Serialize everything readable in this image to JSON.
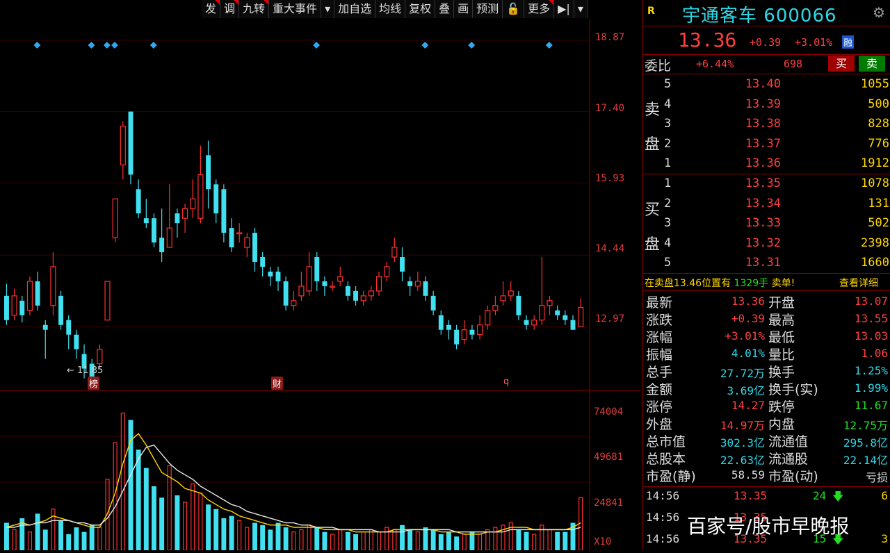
{
  "toolbar": {
    "items": [
      {
        "label": "发",
        "mark": true
      },
      {
        "label": "调",
        "mark": true
      },
      {
        "label": "九转",
        "mark": true
      },
      {
        "label": "重大事件",
        "mark": false
      },
      {
        "label": "▾",
        "mark": false
      },
      {
        "label": "加自选",
        "mark": false
      },
      {
        "label": "均线",
        "mark": false
      },
      {
        "label": "复权",
        "mark": false
      },
      {
        "label": "叠",
        "mark": false
      },
      {
        "label": "画",
        "mark": false
      },
      {
        "label": "预测",
        "mark": false
      },
      {
        "label": "🔓",
        "mark": false
      },
      {
        "label": "更多",
        "mark": true
      },
      {
        "label": "▶|",
        "mark": false
      },
      {
        "label": "▾",
        "mark": false
      }
    ]
  },
  "chart": {
    "price_labels": [
      "18.87",
      "17.40",
      "15.93",
      "14.44",
      "12.97"
    ],
    "low_marker": "11.85",
    "event_badges": [
      {
        "label": "榜",
        "color": "#c00000",
        "bg": "#5a0000"
      },
      {
        "label": "财",
        "color": "#c00000",
        "bg": "#5a0000"
      },
      {
        "label": "q",
        "color": "#c00000",
        "bg": "#000"
      }
    ],
    "volume_labels": [
      "74004",
      "49681",
      "24841"
    ],
    "volume_unit": "X10"
  },
  "chart_data": {
    "type": "candlestick",
    "ylim": [
      11.85,
      18.87
    ],
    "candles": [
      [
        13.6,
        13.1,
        13.85,
        13.0
      ],
      [
        13.2,
        13.6,
        13.75,
        13.1
      ],
      [
        13.5,
        13.2,
        13.6,
        13.05
      ],
      [
        13.3,
        13.9,
        14.0,
        13.2
      ],
      [
        13.9,
        13.4,
        14.1,
        13.3
      ],
      [
        13.0,
        12.9,
        13.1,
        12.3
      ],
      [
        13.4,
        14.2,
        14.5,
        13.2
      ],
      [
        13.6,
        13.0,
        13.7,
        12.9
      ],
      [
        13.1,
        12.8,
        13.2,
        12.5
      ],
      [
        12.8,
        12.5,
        12.9,
        12.3
      ],
      [
        12.4,
        12.1,
        12.6,
        11.9
      ],
      [
        12.2,
        11.9,
        12.3,
        11.85
      ],
      [
        12.2,
        12.5,
        12.6,
        12.1
      ],
      [
        13.1,
        13.9,
        13.9,
        13.1
      ],
      [
        14.8,
        15.6,
        15.6,
        14.7
      ],
      [
        16.3,
        17.1,
        17.2,
        16.0
      ],
      [
        17.4,
        16.1,
        17.4,
        15.9
      ],
      [
        15.8,
        15.3,
        16.0,
        15.2
      ],
      [
        15.2,
        15.1,
        15.6,
        15.0
      ],
      [
        15.2,
        14.7,
        15.3,
        14.6
      ],
      [
        14.8,
        14.5,
        15.4,
        14.3
      ],
      [
        14.6,
        15.0,
        15.9,
        14.6
      ],
      [
        15.3,
        15.1,
        15.4,
        14.8
      ],
      [
        15.2,
        15.4,
        15.5,
        14.9
      ],
      [
        15.4,
        15.6,
        16.0,
        15.2
      ],
      [
        15.2,
        16.1,
        16.7,
        15.1
      ],
      [
        16.5,
        15.8,
        16.8,
        15.4
      ],
      [
        15.9,
        15.3,
        16.0,
        15.1
      ],
      [
        15.8,
        14.9,
        15.9,
        14.7
      ],
      [
        15.0,
        14.6,
        15.2,
        14.5
      ],
      [
        14.9,
        14.9,
        15.1,
        14.7
      ],
      [
        14.6,
        14.8,
        14.9,
        14.4
      ],
      [
        14.9,
        14.3,
        15.0,
        14.1
      ],
      [
        14.4,
        14.2,
        14.5,
        14.0
      ],
      [
        14.1,
        14.0,
        14.2,
        13.8
      ],
      [
        14.1,
        13.9,
        14.2,
        13.7
      ],
      [
        13.9,
        13.4,
        14.0,
        13.3
      ],
      [
        13.4,
        13.5,
        13.7,
        13.3
      ],
      [
        13.6,
        13.8,
        14.1,
        13.5
      ],
      [
        13.7,
        14.2,
        14.5,
        13.6
      ],
      [
        14.4,
        13.9,
        14.5,
        13.7
      ],
      [
        13.9,
        13.8,
        14.0,
        13.6
      ],
      [
        13.8,
        13.8,
        13.9,
        13.7
      ],
      [
        13.9,
        14.0,
        14.2,
        13.8
      ],
      [
        13.8,
        13.6,
        13.9,
        13.5
      ],
      [
        13.7,
        13.5,
        13.8,
        13.4
      ],
      [
        13.5,
        13.6,
        13.7,
        13.4
      ],
      [
        13.6,
        13.7,
        13.8,
        13.5
      ],
      [
        13.7,
        14.0,
        14.1,
        13.6
      ],
      [
        14.0,
        14.2,
        14.3,
        13.9
      ],
      [
        14.4,
        14.6,
        14.8,
        14.3
      ],
      [
        14.4,
        14.1,
        14.6,
        13.9
      ],
      [
        13.9,
        13.8,
        14.0,
        13.6
      ],
      [
        13.8,
        13.9,
        14.1,
        13.7
      ],
      [
        13.9,
        13.6,
        14.0,
        13.5
      ],
      [
        13.6,
        13.3,
        13.7,
        13.2
      ],
      [
        13.2,
        12.9,
        13.3,
        12.8
      ],
      [
        13.0,
        12.9,
        13.1,
        12.7
      ],
      [
        12.9,
        12.6,
        13.0,
        12.5
      ],
      [
        12.7,
        12.9,
        13.1,
        12.6
      ],
      [
        12.9,
        12.8,
        13.0,
        12.7
      ],
      [
        12.8,
        13.0,
        13.2,
        12.7
      ],
      [
        13.0,
        13.3,
        13.4,
        12.9
      ],
      [
        13.3,
        13.4,
        13.6,
        13.2
      ],
      [
        13.5,
        13.6,
        13.9,
        13.4
      ],
      [
        13.6,
        13.7,
        13.9,
        13.5
      ],
      [
        13.6,
        13.2,
        13.7,
        13.1
      ],
      [
        13.1,
        13.0,
        13.2,
        12.9
      ],
      [
        13.0,
        13.1,
        13.2,
        12.9
      ],
      [
        13.1,
        13.4,
        14.4,
        13.0
      ],
      [
        13.4,
        13.5,
        13.6,
        13.2
      ],
      [
        13.3,
        13.2,
        13.4,
        13.1
      ],
      [
        13.2,
        13.1,
        13.3,
        13.0
      ],
      [
        13.1,
        12.9,
        13.2,
        12.9
      ],
      [
        12.97,
        13.36,
        13.55,
        13.03
      ]
    ],
    "signal_markers_at": [
      4,
      11,
      13,
      14,
      19,
      40,
      54,
      60,
      70
    ],
    "volume": [
      12,
      9,
      14,
      8,
      16,
      9,
      18,
      13,
      7,
      10,
      8,
      11,
      10,
      31,
      47,
      60,
      57,
      44,
      36,
      28,
      23,
      37,
      24,
      21,
      29,
      25,
      20,
      18,
      14,
      15,
      13,
      10,
      12,
      11,
      9,
      12,
      10,
      8,
      9,
      11,
      10,
      8,
      7,
      9,
      8,
      7,
      8,
      9,
      8,
      10,
      9,
      11,
      9,
      8,
      10,
      9,
      7,
      8,
      6,
      7,
      8,
      7,
      9,
      10,
      11,
      12,
      9,
      8,
      7,
      11,
      9,
      8,
      8,
      12,
      23
    ],
    "ma5": [
      10,
      11,
      12,
      11,
      12,
      13,
      15,
      14,
      13,
      12,
      11,
      10,
      10,
      16,
      25,
      38,
      48,
      51,
      46,
      40,
      34,
      32,
      30,
      27,
      26,
      25,
      22,
      20,
      18,
      17,
      15,
      14,
      13,
      12,
      11,
      11,
      11,
      10,
      10,
      10,
      10,
      9,
      9,
      9,
      9,
      8,
      8,
      8,
      8,
      8,
      9,
      9,
      9,
      9,
      9,
      9,
      8,
      8,
      8,
      7,
      7,
      7,
      8,
      8,
      9,
      10,
      10,
      10,
      9,
      9,
      9,
      9,
      9,
      10,
      12
    ],
    "ma10": [
      10,
      10,
      11,
      11,
      12,
      12,
      13,
      13,
      13,
      12,
      12,
      11,
      11,
      14,
      19,
      26,
      33,
      40,
      45,
      46,
      42,
      38,
      35,
      33,
      31,
      28,
      26,
      24,
      22,
      20,
      19,
      17,
      16,
      15,
      14,
      13,
      12,
      12,
      11,
      11,
      10,
      10,
      10,
      9,
      9,
      9,
      9,
      9,
      8,
      8,
      8,
      8,
      9,
      9,
      9,
      9,
      9,
      9,
      8,
      8,
      8,
      8,
      8,
      8,
      8,
      9,
      9,
      9,
      9,
      9,
      9,
      9,
      9,
      9,
      10
    ]
  },
  "quote": {
    "flag": "R",
    "name": "宇通客车",
    "code": "600066",
    "price": "13.36",
    "change": "+0.39",
    "pct": "+3.01%",
    "badge": "融",
    "weibi_label": "委比",
    "weibi_pct": "+6.44%",
    "weibi_diff": "698",
    "buy_btn": "买",
    "sell_btn": "卖",
    "sell_side": [
      "卖",
      "盘"
    ],
    "buy_side": [
      "买",
      "盘"
    ],
    "asks": [
      {
        "idx": "5",
        "price": "13.40",
        "vol": "1055"
      },
      {
        "idx": "4",
        "price": "13.39",
        "vol": "500"
      },
      {
        "idx": "3",
        "price": "13.38",
        "vol": "828"
      },
      {
        "idx": "2",
        "price": "13.37",
        "vol": "776"
      },
      {
        "idx": "1",
        "price": "13.36",
        "vol": "1912"
      }
    ],
    "bids": [
      {
        "idx": "1",
        "price": "13.35",
        "vol": "1078"
      },
      {
        "idx": "2",
        "price": "13.34",
        "vol": "131"
      },
      {
        "idx": "3",
        "price": "13.33",
        "vol": "502"
      },
      {
        "idx": "4",
        "price": "13.32",
        "vol": "2398"
      },
      {
        "idx": "5",
        "price": "13.31",
        "vol": "1660"
      }
    ],
    "notice_left": "在卖盘13.46位置有",
    "notice_vol": "1329手",
    "notice_tag": "卖单!",
    "notice_link": "查看详细",
    "stats": [
      {
        "l1": "最新",
        "v1": "13.36",
        "c1": "red",
        "l2": "开盘",
        "v2": "13.07",
        "c2": "red"
      },
      {
        "l1": "涨跌",
        "v1": "+0.39",
        "c1": "red",
        "l2": "最高",
        "v2": "13.55",
        "c2": "red"
      },
      {
        "l1": "涨幅",
        "v1": "+3.01%",
        "c1": "red",
        "l2": "最低",
        "v2": "13.03",
        "c2": "red"
      },
      {
        "l1": "振幅",
        "v1": "4.01%",
        "c1": "cyan",
        "l2": "量比",
        "v2": "1.06",
        "c2": "red"
      },
      {
        "l1": "总手",
        "v1": "27.72万",
        "c1": "cyan",
        "l2": "换手",
        "v2": "1.25%",
        "c2": "cyan"
      },
      {
        "l1": "金额",
        "v1": "3.69亿",
        "c1": "cyan",
        "l2": "换手(实)",
        "v2": "1.99%",
        "c2": "cyan"
      },
      {
        "l1": "涨停",
        "v1": "14.27",
        "c1": "red",
        "l2": "跌停",
        "v2": "11.67",
        "c2": "green"
      },
      {
        "l1": "外盘",
        "v1": "14.97万",
        "c1": "red",
        "l2": "内盘",
        "v2": "12.75万",
        "c2": "green"
      },
      {
        "l1": "总市值",
        "v1": "302.3亿",
        "c1": "cyan",
        "l2": "流通值",
        "v2": "295.8亿",
        "c2": "cyan"
      },
      {
        "l1": "总股本",
        "v1": "22.63亿",
        "c1": "cyan",
        "l2": "流通股",
        "v2": "22.14亿",
        "c2": "cyan"
      },
      {
        "l1": "市盈(静)",
        "v1": "58.59",
        "c1": "white",
        "l2": "市盈(动)",
        "v2": "亏损",
        "c2": "white"
      }
    ],
    "ticks": [
      {
        "time": "14:56",
        "price": "13.35",
        "vol": "24",
        "dir": "down",
        "n": "6"
      },
      {
        "time": "14:56",
        "price": "13.35",
        "vol": "",
        "dir": "",
        "n": ""
      },
      {
        "time": "14:56",
        "price": "13.35",
        "vol": "15",
        "dir": "down",
        "n": "3"
      }
    ]
  },
  "watermark": "百家号/股市早晚报"
}
